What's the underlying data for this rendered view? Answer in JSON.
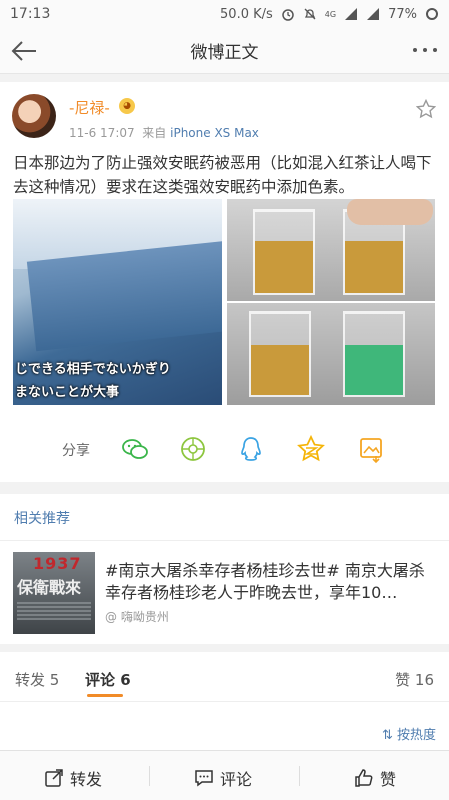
{
  "statusbar": {
    "time": "17:13",
    "net_speed": "50.0 K/s",
    "signal_label": "4G",
    "battery": "77%"
  },
  "nav": {
    "title": "微博正文"
  },
  "post": {
    "username": "-尼禄-",
    "time": "11-6 17:07",
    "source_prefix": "来自",
    "device": "iPhone XS Max",
    "text": "日本那边为了防止强效安眠药被恶用（比如混入红茶让人喝下去这种情况）要求在这类强效安眠药中添加色素。",
    "image_subtitle_1": "じできる相手でないかぎり",
    "image_subtitle_2": "まないことが大事"
  },
  "share": {
    "label": "分享",
    "icons": [
      "wechat-icon",
      "moments-icon",
      "qq-icon",
      "qzone-icon",
      "save-image-icon"
    ]
  },
  "recommend": {
    "header": "相关推荐",
    "title": "#南京大屠杀幸存者杨桂珍去世# 南京大屠杀幸存者杨桂珍老人于昨晚去世，享年10…",
    "source": "嗨呦贵州",
    "thumb_year": "1937",
    "thumb_text": "保衛戰來"
  },
  "tabs": {
    "repost": "转发 5",
    "comment": "评论 6",
    "like": "赞 16"
  },
  "sort": {
    "label": "按热度"
  },
  "bottom": {
    "repost": "转发",
    "comment": "评论",
    "like": "赞"
  },
  "colors": {
    "accent_orange": "#f18b28",
    "link_blue": "#507daf"
  }
}
